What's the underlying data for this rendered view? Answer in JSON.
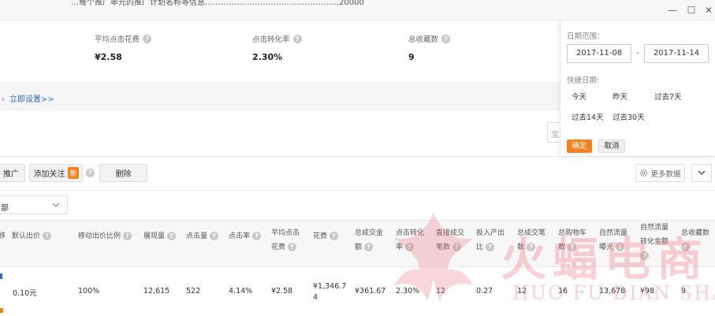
{
  "titlebar": {
    "cut_text": "…每个推广单元的推广计划名称等信息……………………………………………20000",
    "minimize": "—",
    "maximize": "☐",
    "close": "✕"
  },
  "metrics": [
    {
      "label": "平均点击花费",
      "value": "¥2.58"
    },
    {
      "label": "点击转化率",
      "value": "2.30%"
    },
    {
      "label": "总收藏数",
      "value": "9"
    }
  ],
  "setup": {
    "link": "立即设置>>",
    "left_fragment": "。"
  },
  "search": {
    "placeholder_stub": "宝"
  },
  "toolbar": {
    "promote_label": "推广",
    "follow_label": "添加关注",
    "new_badge": "新",
    "delete_label": "删除",
    "more_data_label": "更多数据"
  },
  "filter": {
    "selected": "部"
  },
  "table": {
    "headers": [
      {
        "line1": "移",
        "line2": ""
      },
      {
        "line1": "默认出价",
        "line2": ""
      },
      {
        "line1": "移动出价比例",
        "line2": ""
      },
      {
        "line1": "展现量",
        "line2": ""
      },
      {
        "line1": "点击量",
        "line2": ""
      },
      {
        "line1": "点击率",
        "line2": ""
      },
      {
        "line1": "平均点击",
        "line2": "花费"
      },
      {
        "line1": "花费",
        "line2": ""
      },
      {
        "line1": "总成交金",
        "line2": "额"
      },
      {
        "line1": "点击转化",
        "line2": "率"
      },
      {
        "line1": "直接成交",
        "line2": "笔数"
      },
      {
        "line1": "投入产出",
        "line2": "比"
      },
      {
        "line1": "总成交笔",
        "line2": "数"
      },
      {
        "line1": "总购物车",
        "line2": "数"
      },
      {
        "line1": "自然流量",
        "line2": "曝光"
      },
      {
        "line1": "自然流量",
        "line2": "转化金额"
      },
      {
        "line1": "总收藏数",
        "line2": ""
      }
    ],
    "row": {
      "bid": "0.10元",
      "mobile_ratio": "100%",
      "impressions": "12,615",
      "clicks": "522",
      "ctr": "4.14%",
      "avg_cpc": "¥2.58",
      "cost_line1": "¥1,346.7",
      "cost_line2": "4",
      "gmv": "¥361.67",
      "cvr": "2.30%",
      "direct_orders": "12",
      "roi": "0.27",
      "total_orders": "12",
      "cart": "16",
      "natural_exposure": "13,678",
      "natural_gmv": "¥98",
      "favorites": "9"
    }
  },
  "date_panel": {
    "range_label": "日期范围：",
    "start": "2017-11-08",
    "dash": "-",
    "end": "2017-11-14",
    "quick_label": "快捷日期:",
    "quick_options": [
      "今天",
      "昨天",
      "过去7天",
      "过去14天",
      "过去30天"
    ],
    "confirm": "确定",
    "cancel": "取消"
  },
  "watermark": {
    "cn": "火蝠电商",
    "en": "HUO FU DIAN SHANG"
  },
  "colors": {
    "accent": "#f5811f",
    "link": "#2e6bc6",
    "watermark": "#eb7887"
  }
}
